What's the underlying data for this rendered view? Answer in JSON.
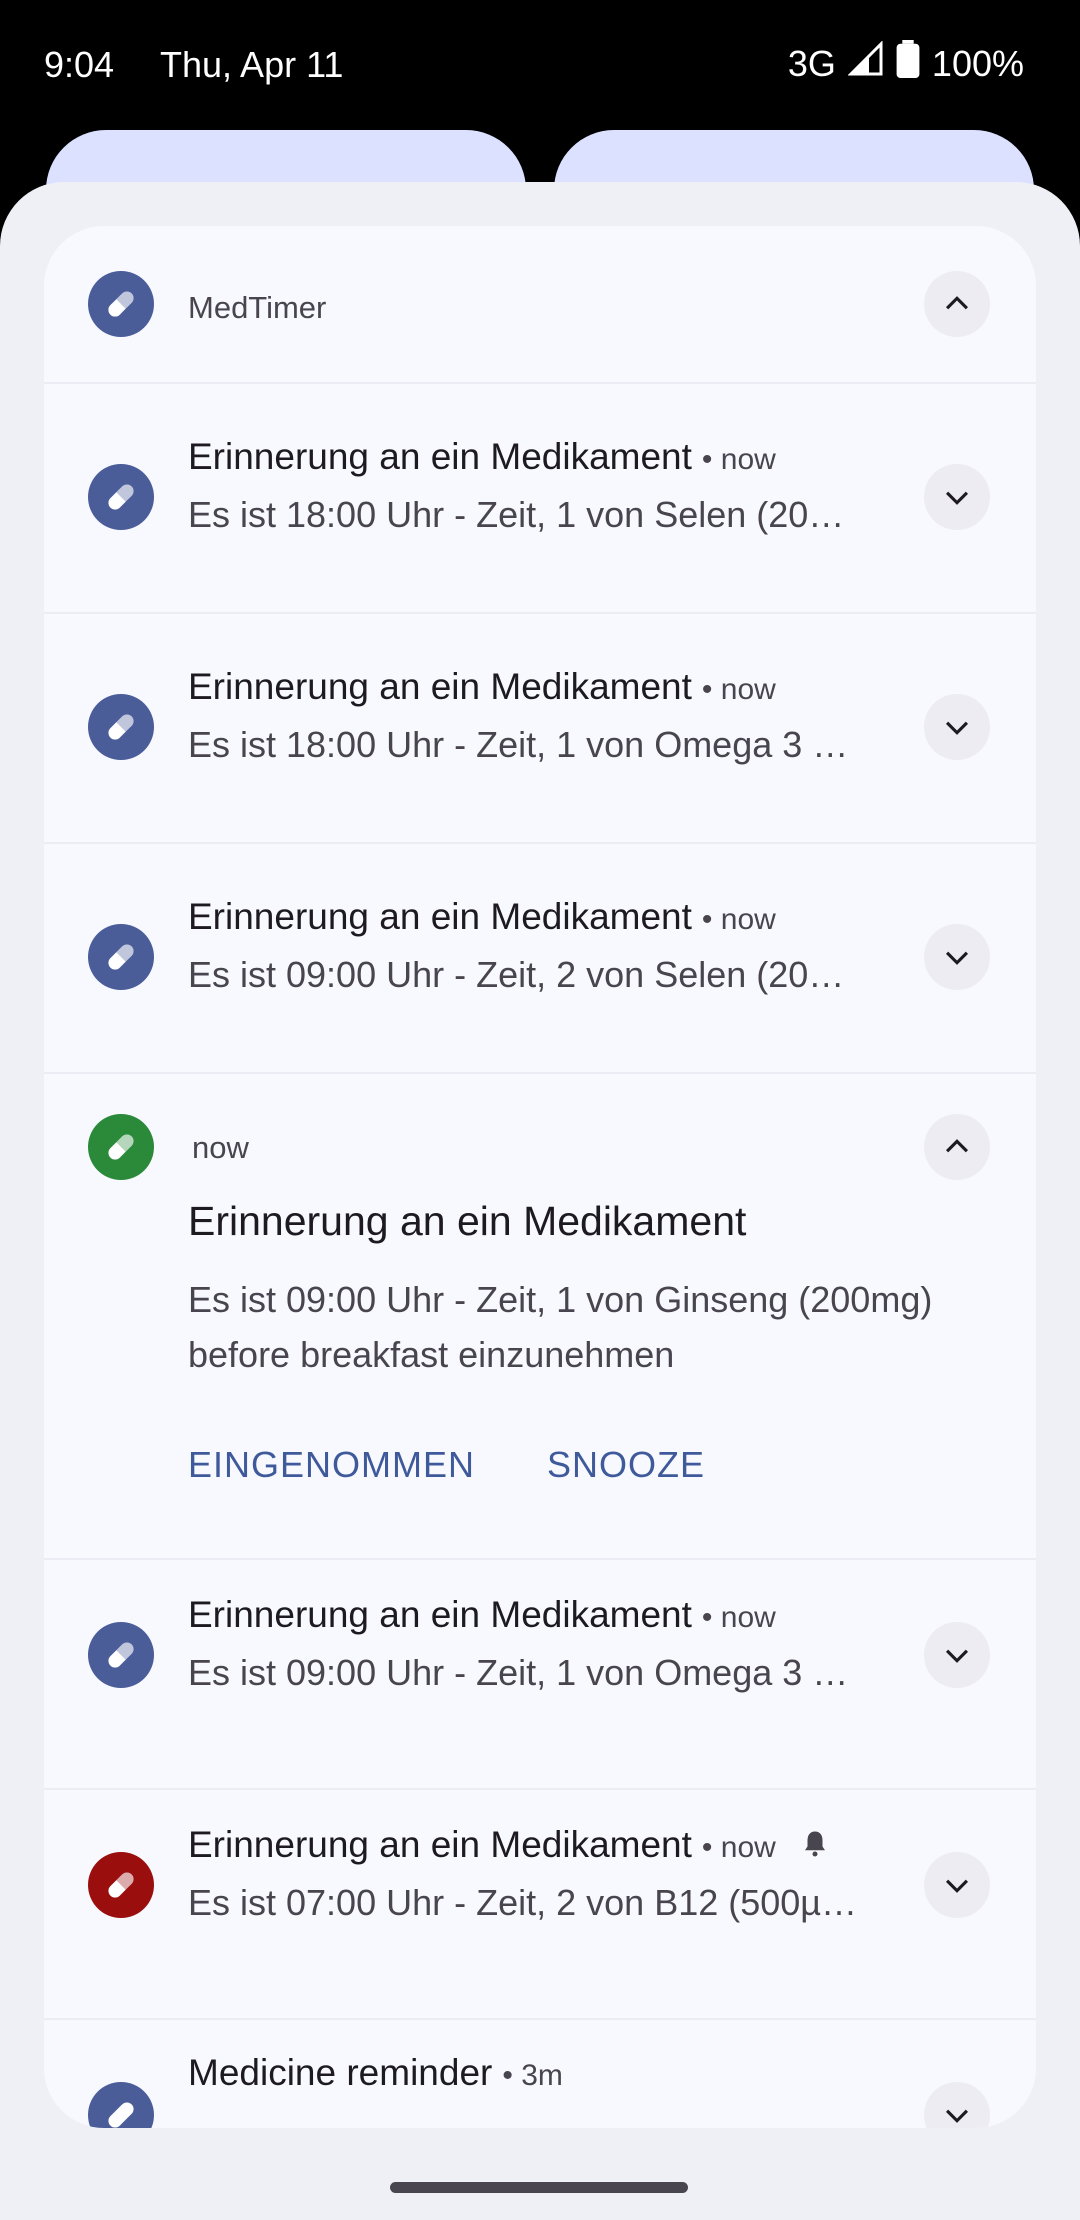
{
  "status_bar": {
    "time": "9:04",
    "date": "Thu, Apr 11",
    "network": "3G",
    "battery": "100%"
  },
  "group": {
    "app_name": "MedTimer"
  },
  "colors": {
    "blue": "#4a5d99",
    "green": "#2a8a3a",
    "red": "#9a0e0e",
    "accent_text": "#3f5a9a"
  },
  "notifications": [
    {
      "title": "Erinnerung an ein Medikament",
      "time": "now",
      "text": "Es ist 18:00 Uhr - Zeit, 1 von Selen (20…",
      "icon_color": "#4a5d99"
    },
    {
      "title": "Erinnerung an ein Medikament",
      "time": "now",
      "text": "Es ist 18:00 Uhr - Zeit, 1 von Omega 3 …",
      "icon_color": "#4a5d99"
    },
    {
      "title": "Erinnerung an ein Medikament",
      "time": "now",
      "text": "Es ist 09:00 Uhr - Zeit, 2 von Selen (20…",
      "icon_color": "#4a5d99"
    }
  ],
  "expanded": {
    "time": "now",
    "title": "Erinnerung an ein Medikament",
    "text_line1": "Es ist 09:00 Uhr - Zeit, 1 von Ginseng (200mg)",
    "text_line2": "before breakfast einzunehmen",
    "action_taken": "EINGENOMMEN",
    "action_snooze": "SNOOZE"
  },
  "notifications_after": [
    {
      "title": "Erinnerung an ein Medikament",
      "time": "now",
      "text": "Es ist 09:00 Uhr - Zeit, 1 von Omega 3 …"
    },
    {
      "title": "Erinnerung an ein Medikament",
      "time": "now",
      "text": "Es ist 07:00 Uhr - Zeit, 2 von B12 (500µ…"
    }
  ],
  "partial": {
    "title": "Medicine reminder",
    "time": "3m"
  }
}
